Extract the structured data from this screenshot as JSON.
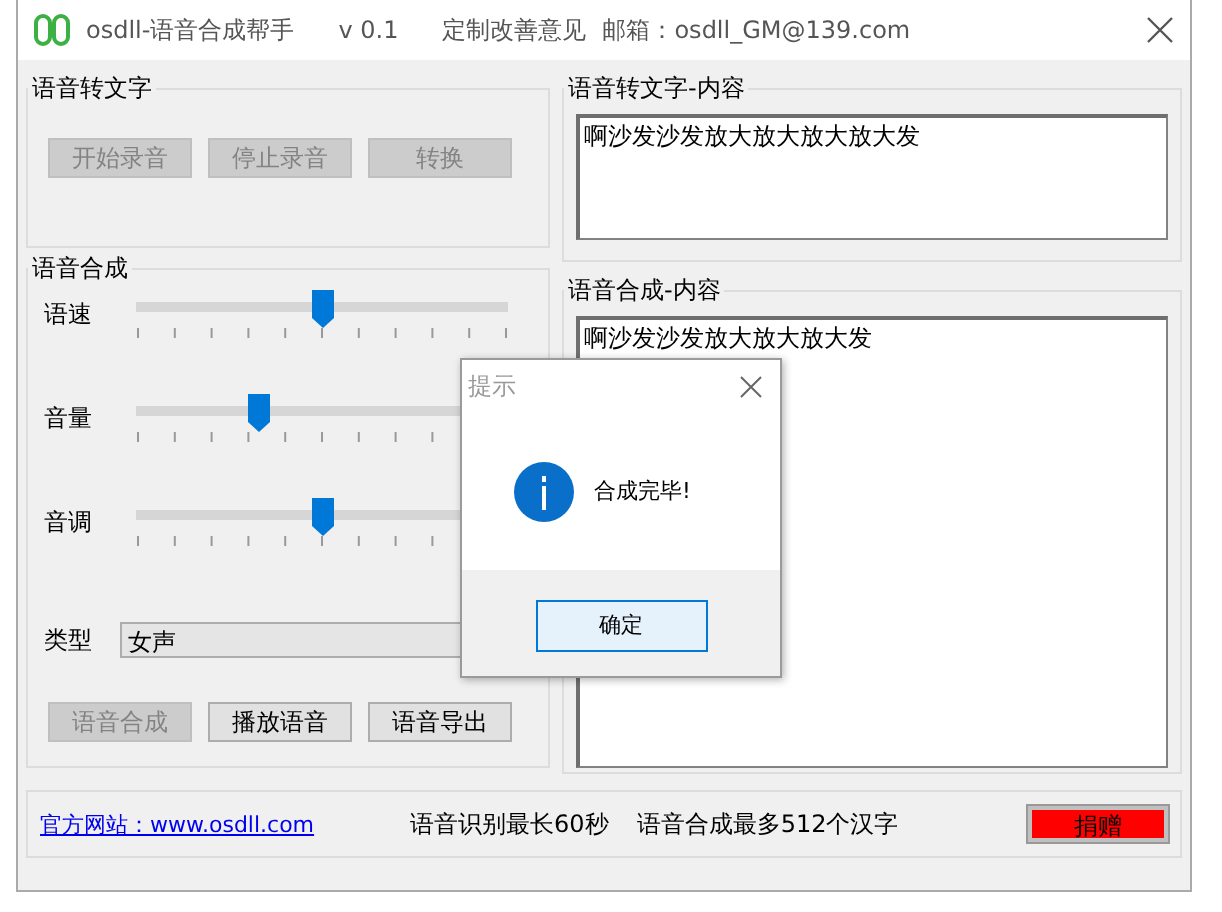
{
  "window": {
    "title": "osdll-语音合成帮手",
    "version": "v 0.1",
    "feedback": "定制改善意见",
    "email": "邮箱：osdll_GM@139.com"
  },
  "speech_to_text": {
    "title": "语音转文字",
    "buttons": [
      {
        "label": "开始录音",
        "disabled": true
      },
      {
        "label": "停止录音",
        "disabled": true
      },
      {
        "label": "转换",
        "disabled": true
      }
    ]
  },
  "synthesis": {
    "title": "语音合成",
    "sliders": [
      {
        "label": "语速",
        "level": 0.5
      },
      {
        "label": "音量",
        "level": 0.33
      },
      {
        "label": "音调",
        "level": 0.5
      }
    ],
    "type_label": "类型",
    "type_value": "女声",
    "buttons": [
      {
        "label": "语音合成",
        "disabled": true
      },
      {
        "label": "播放语音",
        "disabled": false
      },
      {
        "label": "语音导出",
        "disabled": false
      }
    ]
  },
  "stt_content": {
    "title": "语音转文字-内容",
    "text": "啊沙发沙发放大放大放大放大发"
  },
  "synth_content": {
    "title": "语音合成-内容",
    "text": "啊沙发沙发放大放大放大发"
  },
  "footer": {
    "link": "官方网站：www.osdll.com",
    "note_1": "语音识别最长60秒",
    "note_2": "语音合成最多512个汉字",
    "donate": "捐赠"
  },
  "dialog": {
    "title": "提示",
    "message": "合成完毕!",
    "ok": "确定"
  }
}
